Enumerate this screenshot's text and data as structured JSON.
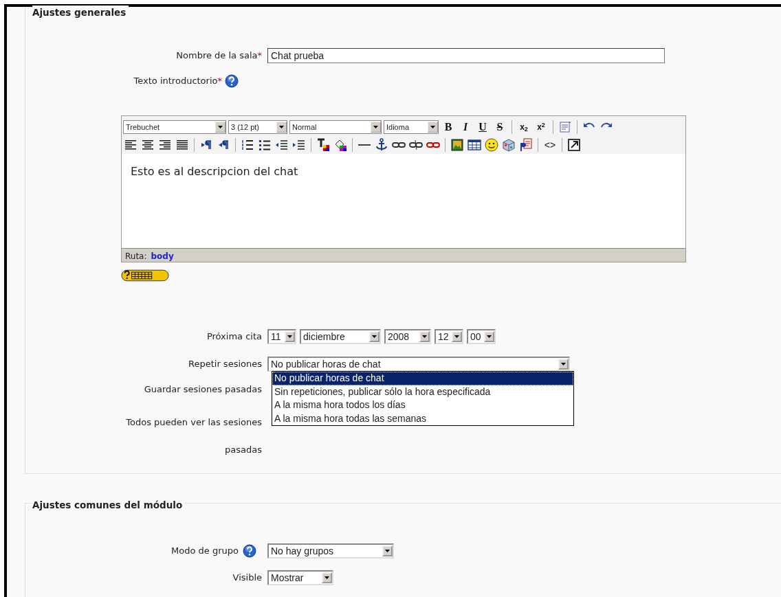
{
  "general": {
    "legend": "Ajustes generales",
    "name_field": {
      "label": "Nombre de la sala",
      "required_mark": "*",
      "value": "Chat prueba"
    },
    "intro": {
      "label": "Texto introductorio",
      "required_mark": "*"
    },
    "editor": {
      "toolbar_rows": [
        [
          {
            "kind": "select",
            "value": "Trebuchet"
          },
          {
            "kind": "select",
            "value": "3 (12 pt)"
          },
          {
            "kind": "select",
            "value": "Normal"
          },
          {
            "kind": "select",
            "value": "Idioma"
          },
          {
            "kind": "glyph",
            "label": "B"
          },
          {
            "kind": "glyph",
            "label": "I"
          },
          {
            "kind": "glyph",
            "label": "U"
          },
          {
            "kind": "glyph",
            "label": "S"
          },
          {
            "kind": "sep"
          },
          {
            "kind": "glyph",
            "label": "x$_{2}$"
          },
          {
            "kind": "glyph",
            "label": "x$^{2}$"
          },
          {
            "kind": "sep"
          },
          {
            "kind": "icon"
          },
          {
            "kind": "sep"
          },
          {
            "kind": "icon"
          },
          {
            "kind": "icon"
          }
        ],
        [
          {
            "kind": "icon"
          },
          {
            "kind": "icon"
          },
          {
            "kind": "icon"
          },
          {
            "kind": "icon"
          },
          {
            "kind": "sep"
          },
          {
            "kind": "icon"
          },
          {
            "kind": "icon"
          },
          {
            "kind": "sep"
          },
          {
            "kind": "icon"
          },
          {
            "kind": "icon"
          },
          {
            "kind": "icon"
          },
          {
            "kind": "icon"
          },
          {
            "kind": "sep"
          },
          {
            "kind": "icon"
          },
          {
            "kind": "icon"
          },
          {
            "kind": "sep"
          },
          {
            "kind": "icon"
          },
          {
            "kind": "icon"
          },
          {
            "kind": "icon"
          },
          {
            "kind": "icon"
          },
          {
            "kind": "icon"
          },
          {
            "kind": "sep"
          },
          {
            "kind": "icon"
          },
          {
            "kind": "icon"
          },
          {
            "kind": "icon"
          },
          {
            "kind": "icon"
          },
          {
            "kind": "icon"
          },
          {
            "kind": "sep"
          },
          {
            "kind": "glyph",
            "label": "<>"
          },
          {
            "kind": "sep"
          },
          {
            "kind": "icon"
          }
        ]
      ],
      "content": "Esto es al descripcion del chat",
      "path_label": "Ruta:",
      "path_value": "body"
    },
    "next_date": {
      "label": "Próxima cita",
      "selects": [
        {
          "value": "11"
        },
        {
          "value": "diciembre"
        },
        {
          "value": "2008"
        },
        {
          "value": "12"
        },
        {
          "value": "00"
        }
      ]
    },
    "repeat": {
      "label": "Repetir sesiones",
      "value": "No publicar horas de chat",
      "expanded": true,
      "options": [
        {
          "label": "No publicar horas de chat",
          "selected": true
        },
        {
          "label": "Sin repeticiones, publicar sólo la hora especificada",
          "selected": false
        },
        {
          "label": "A la misma hora todos los días",
          "selected": false
        },
        {
          "label": "A la misma hora todas las semanas",
          "selected": false
        }
      ]
    },
    "keep_label": "Guardar sesiones pasadas",
    "everyone_label": "Todos pueden ver las sesiones pasadas"
  },
  "common": {
    "legend": "Ajustes comunes del módulo",
    "group_mode": {
      "label": "Modo de grupo",
      "value": "No hay grupos"
    },
    "visible": {
      "label": "Visible",
      "value": "Mostrar"
    }
  }
}
